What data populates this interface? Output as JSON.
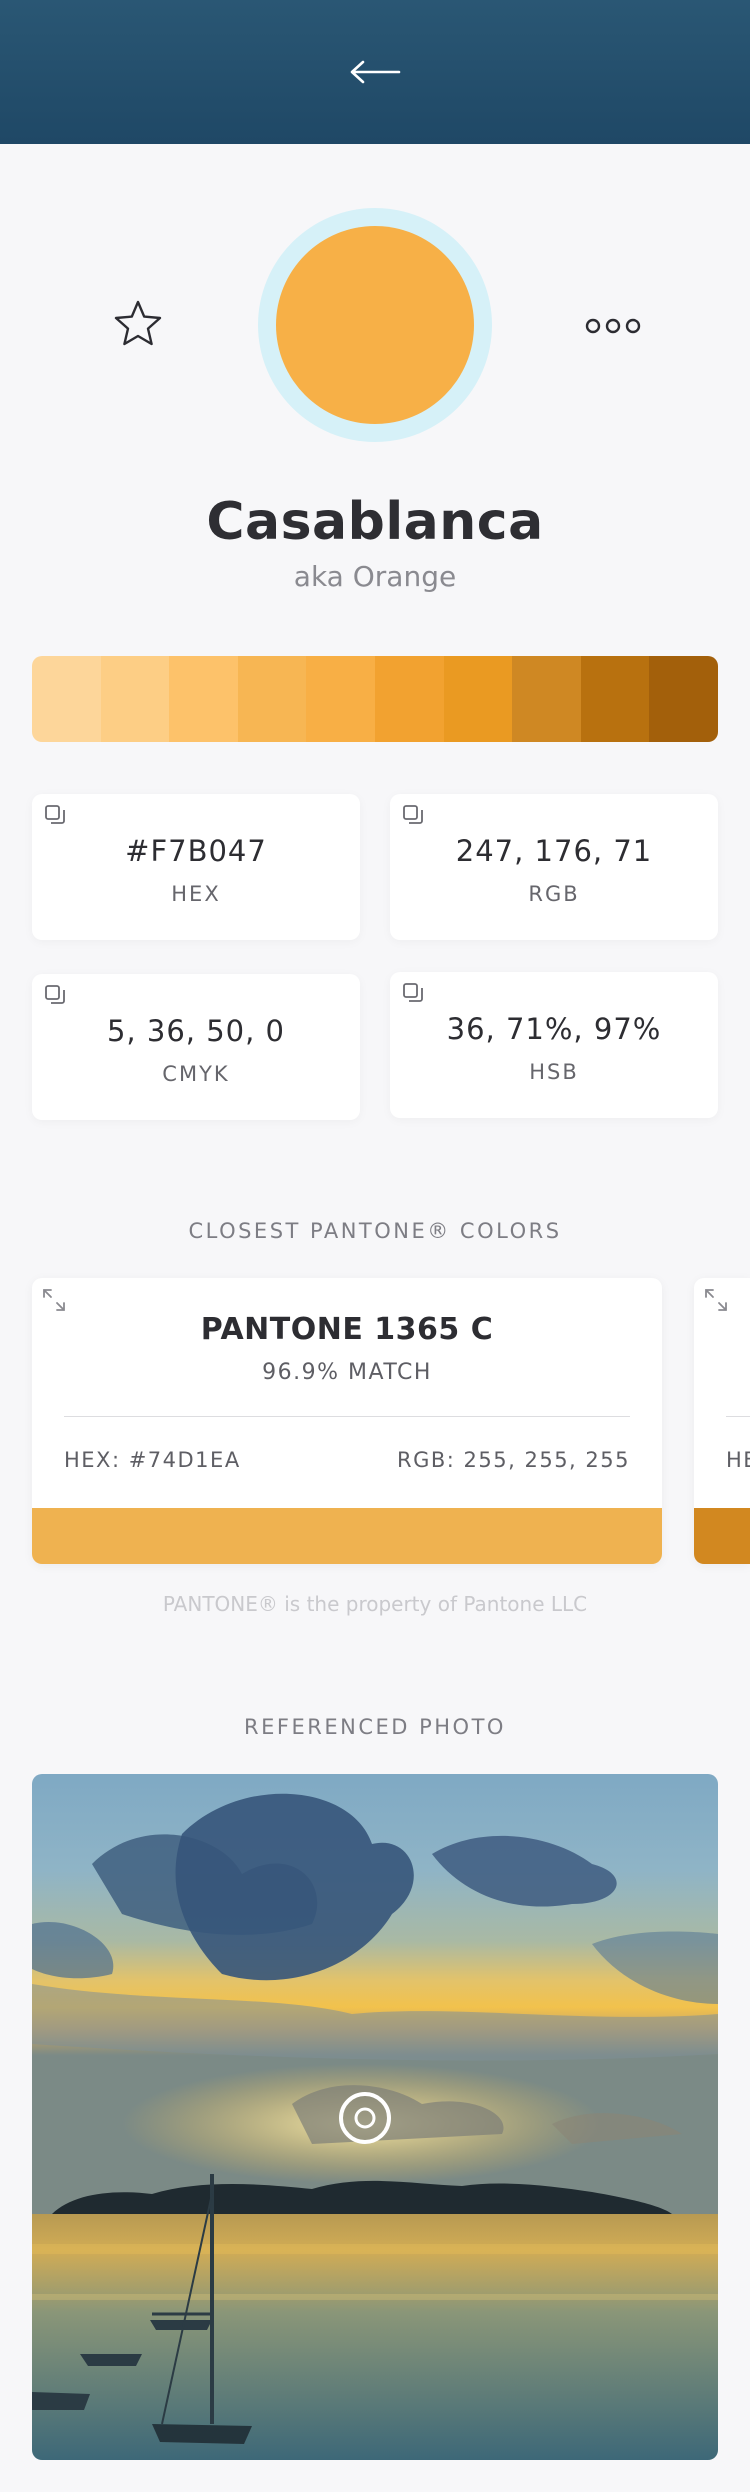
{
  "header": {
    "back_icon": "arrow-left-icon"
  },
  "actions": {
    "favorite_icon": "star-icon",
    "more_icon": "more-horizontal-icon"
  },
  "color": {
    "name": "Casablanca",
    "alias": "aka Orange",
    "hex": "#F7B047",
    "ring_color": "#D6F1F8"
  },
  "shades": [
    "#FDD69A",
    "#FDCE85",
    "#FDC26A",
    "#F7B653",
    "#F8AF45",
    "#F2A230",
    "#EA9A22",
    "#CF8823",
    "#B8710F",
    "#A3600B"
  ],
  "values": [
    {
      "value": "#F7B047",
      "label": "HEX"
    },
    {
      "value": "247, 176, 71",
      "label": "RGB"
    },
    {
      "value": "5, 36, 50, 0",
      "label": "CMYK"
    },
    {
      "value": "36, 71%, 97%",
      "label": "HSB"
    }
  ],
  "pantone": {
    "title": "CLOSEST PANTONE® COLORS",
    "cards": [
      {
        "name": "PANTONE 1365 C",
        "match": "96.9% MATCH",
        "hex": "HEX: #74D1EA",
        "rgb": "RGB: 255, 255, 255",
        "bar_color": "#EFB250"
      },
      {
        "name": "",
        "match": "",
        "hex": "HE",
        "rgb": "",
        "bar_color": "#D28820"
      }
    ],
    "note": "PANTONE® is the property of Pantone LLC"
  },
  "photo": {
    "title": "REFERENCED PHOTO"
  }
}
